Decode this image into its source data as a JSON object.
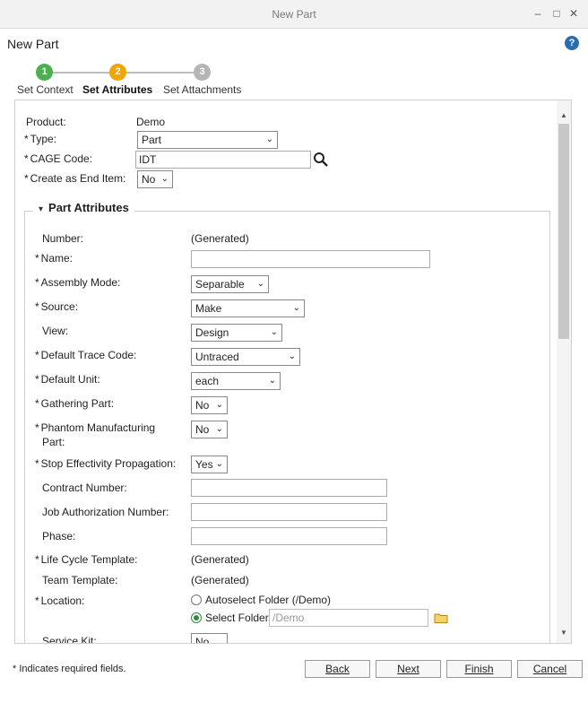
{
  "window": {
    "title": "New Part",
    "minimize": "–",
    "maximize": "□",
    "close": "✕"
  },
  "header": {
    "title": "New Part",
    "help": "?"
  },
  "steps": [
    {
      "num": "1",
      "label": "Set Context",
      "color": "#4caf50"
    },
    {
      "num": "2",
      "label": "Set Attributes",
      "color": "#f0a500"
    },
    {
      "num": "3",
      "label": "Set Attachments",
      "color": "#b5b5b5"
    }
  ],
  "context": {
    "product_label": "Product:",
    "product_value": "Demo",
    "type_label": "Type:",
    "type_value": "Part",
    "cage_label": "CAGE Code:",
    "cage_value": "IDT",
    "end_item_label": "Create as End Item:",
    "end_item_value": "No"
  },
  "required_mark": "*",
  "section": {
    "title": "Part Attributes",
    "number_label": "Number:",
    "number_value": "(Generated)",
    "name_label": "Name:",
    "name_value": "",
    "assembly_label": "Assembly Mode:",
    "assembly_value": "Separable",
    "source_label": "Source:",
    "source_value": "Make",
    "view_label": "View:",
    "view_value": "Design",
    "trace_label": "Default Trace Code:",
    "trace_value": "Untraced",
    "unit_label": "Default Unit:",
    "unit_value": "each",
    "gathering_label": "Gathering Part:",
    "gathering_value": "No",
    "phantom_label_1": "Phantom Manufacturing",
    "phantom_label_2": "Part:",
    "phantom_value": "No",
    "stop_label": "Stop Effectivity Propagation:",
    "stop_value": "Yes",
    "contract_label": "Contract Number:",
    "contract_value": "",
    "job_label": "Job Authorization Number:",
    "job_value": "",
    "phase_label": "Phase:",
    "phase_value": "",
    "lifecycle_label": "Life Cycle Template:",
    "lifecycle_value": "(Generated)",
    "team_label": "Team Template:",
    "team_value": "(Generated)",
    "location_label": "Location:",
    "location_auto": "Autoselect Folder (/Demo)",
    "location_select": "Select Folder",
    "location_path": "/Demo",
    "service_label": "Service Kit:",
    "service_value": "No"
  },
  "footer": {
    "note": "* Indicates required fields.",
    "back": "Back",
    "next": "Next",
    "finish": "Finish",
    "cancel": "Cancel"
  }
}
